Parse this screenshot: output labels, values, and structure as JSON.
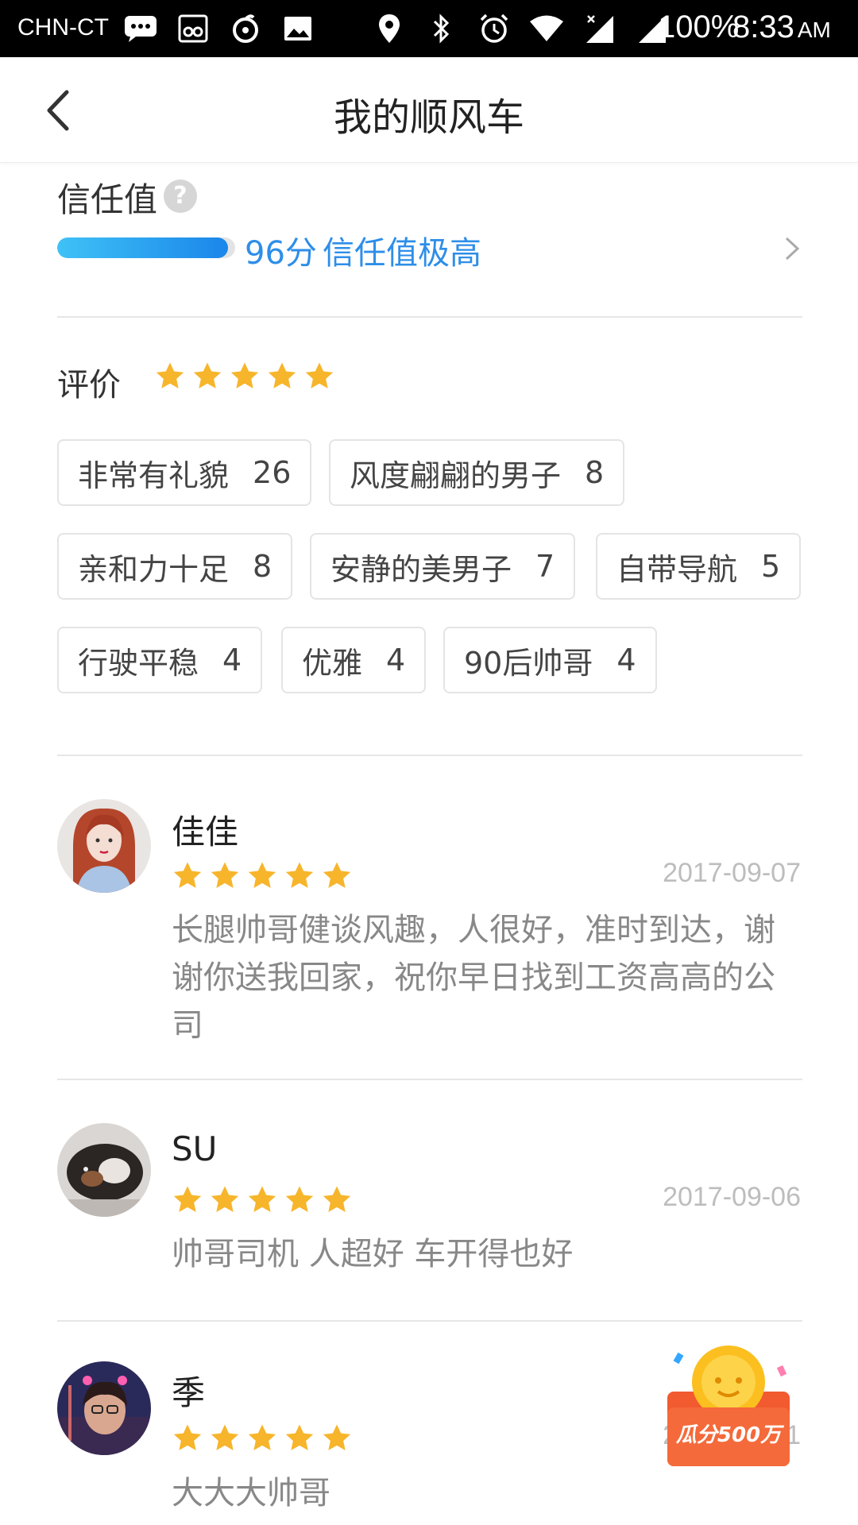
{
  "status_bar": {
    "carrier": "CHN-CT",
    "battery": "100%",
    "time": "8:33",
    "ampm": "AM"
  },
  "header": {
    "title": "我的顺风车"
  },
  "trust": {
    "label": "信任值",
    "score_text": "96分",
    "score_fraction": 0.96,
    "description": "信任值极高"
  },
  "rating": {
    "label": "评价",
    "stars": 5
  },
  "tags": [
    {
      "label": "非常有礼貌",
      "count": "26"
    },
    {
      "label": "风度翩翩的男子",
      "count": "8"
    },
    {
      "label": "亲和力十足",
      "count": "8"
    },
    {
      "label": "安静的美男子",
      "count": "7"
    },
    {
      "label": "自带导航",
      "count": "5"
    },
    {
      "label": "行驶平稳",
      "count": "4"
    },
    {
      "label": "优雅",
      "count": "4"
    },
    {
      "label": "90后帅哥",
      "count": "4"
    }
  ],
  "reviews": [
    {
      "name": "佳佳",
      "stars": 5,
      "date": "2017-09-07",
      "text": "长腿帅哥健谈风趣，人很好，准时到达，谢谢你送我回家，祝你早日找到工资高高的公司"
    },
    {
      "name": "SU",
      "stars": 5,
      "date": "2017-09-06",
      "text": "帅哥司机 人超好 车开得也好"
    },
    {
      "name": "季",
      "stars": 5,
      "date": "2017-09-01",
      "text": "大大大帅哥"
    }
  ],
  "promo": {
    "label": "瓜分500万"
  },
  "colors": {
    "accent": "#2d8ee8",
    "star": "#f7b52c"
  }
}
